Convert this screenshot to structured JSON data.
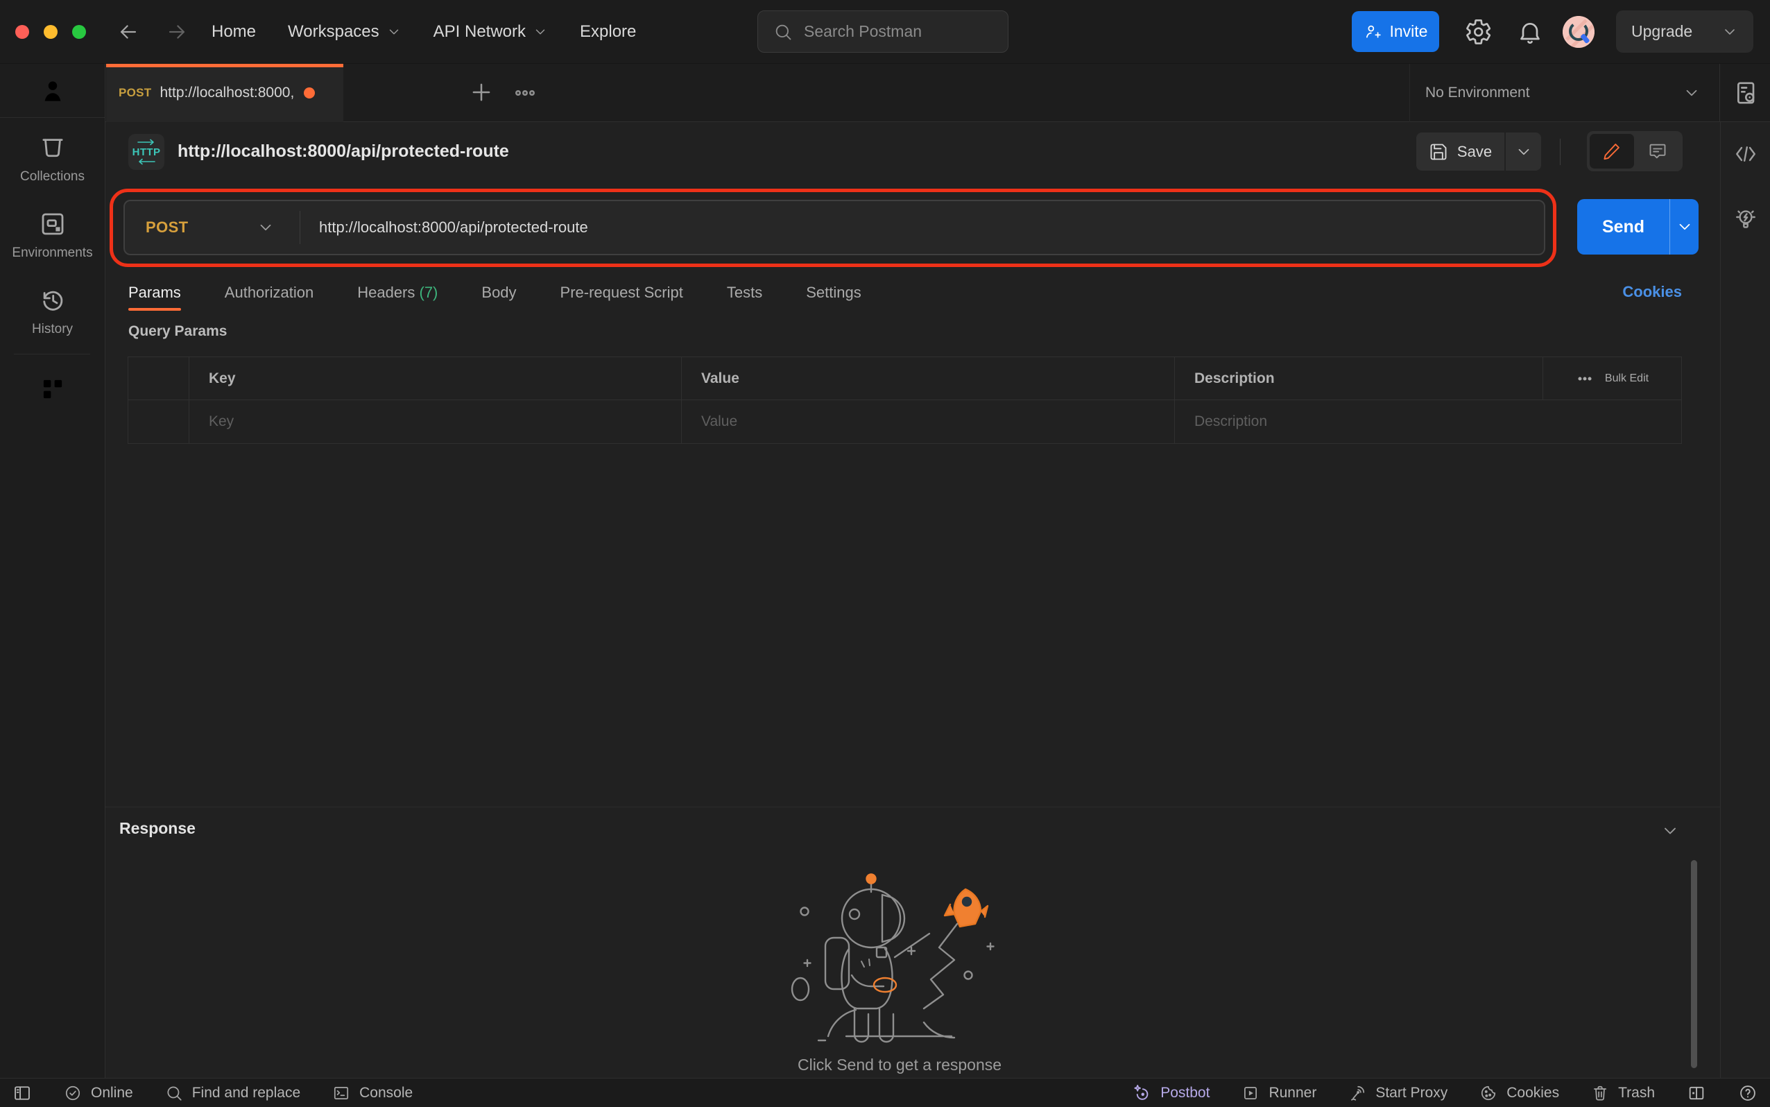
{
  "colors": {
    "accent_orange": "#ff6c37",
    "method_post_yellow": "#d7a03c",
    "primary_blue": "#1673e8",
    "link_blue": "#4a90e6",
    "headers_count_green": "#3db47c",
    "http_badge_teal": "#3cc6b8",
    "postbot_lavender": "#b6a9e8",
    "annotation_red": "#ee3118"
  },
  "topbar": {
    "nav": [
      {
        "label": "Home"
      },
      {
        "label": "Workspaces"
      },
      {
        "label": "API Network"
      },
      {
        "label": "Explore"
      }
    ],
    "search_placeholder": "Search Postman",
    "invite_label": "Invite",
    "upgrade_label": "Upgrade"
  },
  "activity_bar": {
    "items": [
      {
        "label": "Collections"
      },
      {
        "label": "Environments"
      },
      {
        "label": "History"
      }
    ]
  },
  "tab_strip": {
    "active_tab": {
      "method": "POST",
      "title": "http://localhost:8000,"
    },
    "environment_selector": "No Environment"
  },
  "request": {
    "http_badge": "HTTP",
    "title": "http://localhost:8000/api/protected-route",
    "save_label": "Save",
    "method": "POST",
    "url": "http://localhost:8000/api/protected-route",
    "send_label": "Send",
    "tabs": [
      {
        "label": "Params",
        "active": true
      },
      {
        "label": "Authorization"
      },
      {
        "label": "Headers",
        "badge": "(7)"
      },
      {
        "label": "Body"
      },
      {
        "label": "Pre-request Script"
      },
      {
        "label": "Tests"
      },
      {
        "label": "Settings"
      }
    ],
    "cookies_link": "Cookies",
    "query_params": {
      "section_title": "Query Params",
      "columns": {
        "key": "Key",
        "value": "Value",
        "description": "Description"
      },
      "bulk_edit_label": "Bulk Edit",
      "placeholder_row": {
        "key": "Key",
        "value": "Value",
        "description": "Description"
      }
    }
  },
  "response": {
    "title": "Response",
    "empty_message": "Click Send to get a response"
  },
  "status_bar": {
    "online_label": "Online",
    "find_label": "Find and replace",
    "console_label": "Console",
    "postbot_label": "Postbot",
    "runner_label": "Runner",
    "proxy_label": "Start Proxy",
    "cookies_label": "Cookies",
    "trash_label": "Trash"
  }
}
